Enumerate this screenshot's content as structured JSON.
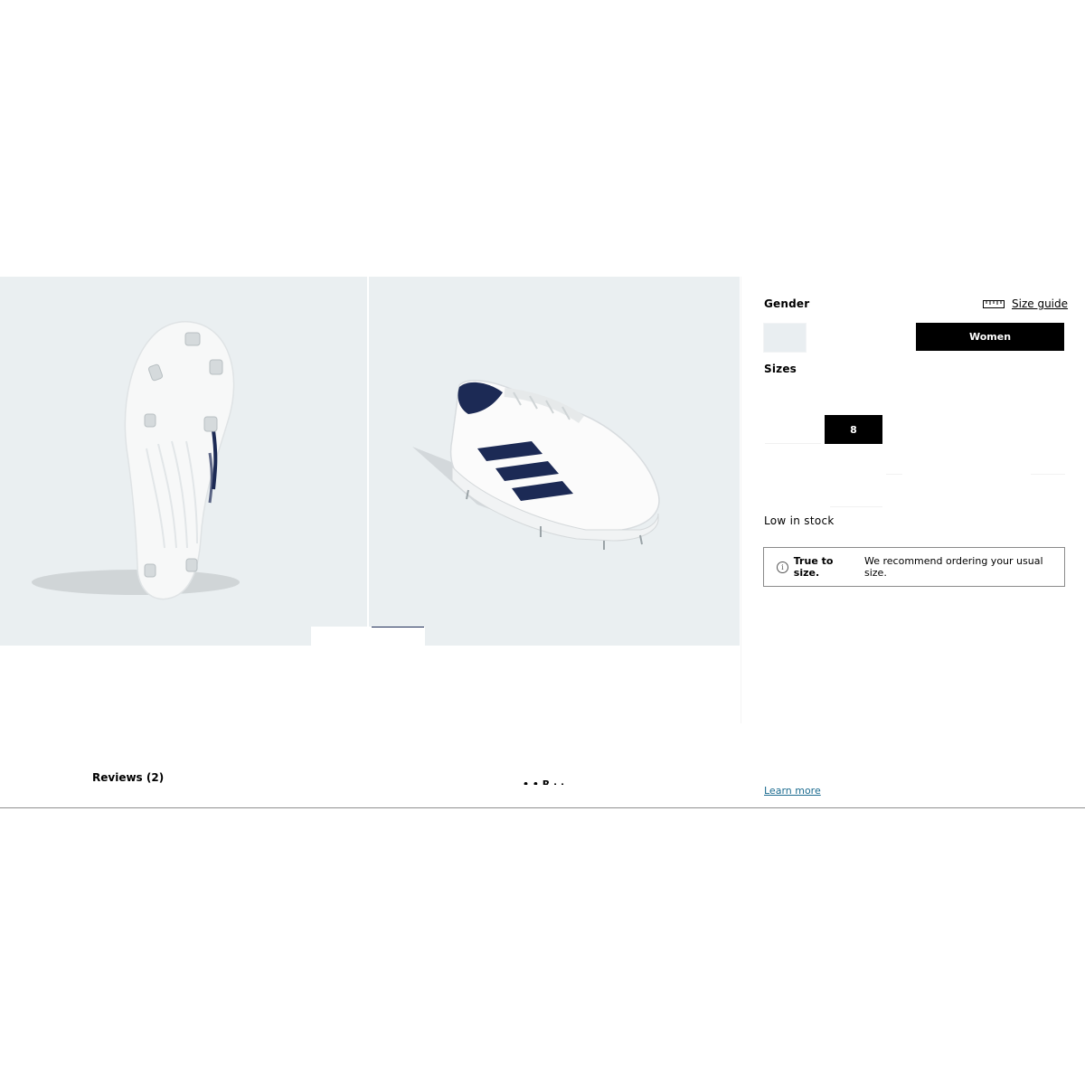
{
  "gallery": {
    "images": [
      {
        "alt": "Cleat outsole view"
      },
      {
        "alt": "Cleat side angle view"
      }
    ]
  },
  "sizing": {
    "gender_label": "Gender",
    "size_guide_label": "Size guide",
    "gender_selected": "Women",
    "sizes_label": "Sizes",
    "selected_size": "8",
    "stock_status": "Low in stock",
    "fit_notice_bold": "True to size.",
    "fit_notice_text": "We recommend ordering your usual size."
  },
  "footer": {
    "reviews_label": "Reviews (2)",
    "partial_text": "• • R · ·",
    "learn_more": "Learn more"
  },
  "icons": {
    "size_guide": "ruler-icon",
    "notice": "info-icon"
  },
  "colors": {
    "image_bg": "#eaeff1",
    "accent": "#000000",
    "stripe": "#1c2a55",
    "link": "#1b6b8f"
  }
}
